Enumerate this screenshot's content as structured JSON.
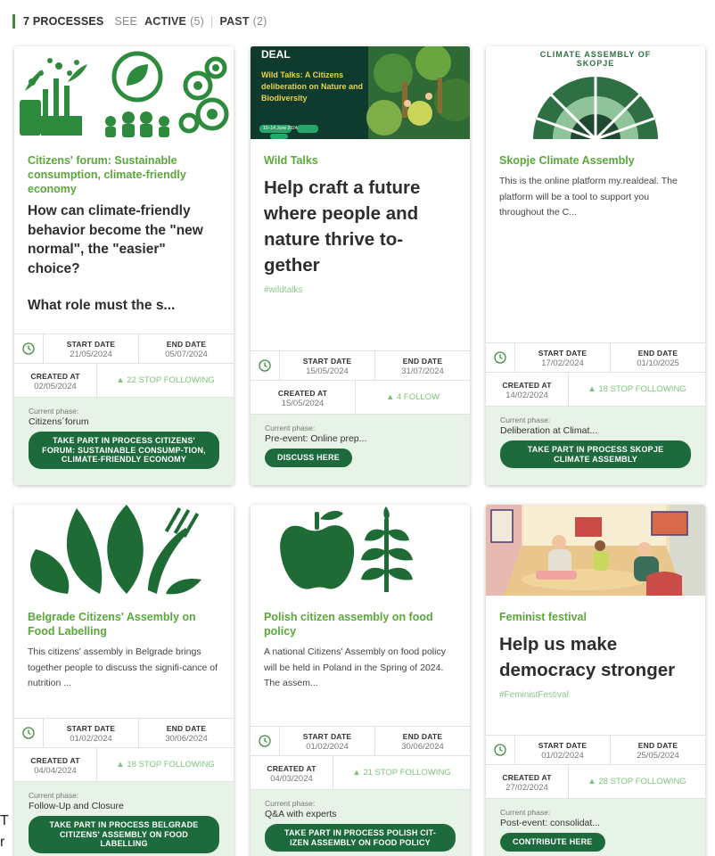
{
  "filter": {
    "total": "7 PROCESSES",
    "see": "SEE",
    "active_label": "ACTIVE",
    "active_count": "(5)",
    "separator": "|",
    "past_label": "PAST",
    "past_count": "(2)"
  },
  "labels": {
    "start_date": "START DATE",
    "end_date": "END DATE",
    "created_at": "CREATED AT",
    "current_phase": "Current phase:"
  },
  "colors": {
    "accent_green": "#5aa83a",
    "button_green": "#1d6b3c",
    "footer_bg": "#e6f3e6"
  },
  "cards": [
    {
      "title": "Citizens' forum: Sustainable consumption, climate-friendly economy",
      "subtitle": "How can climate-friendly behavior become the \"new normal\", the \"easier\" choice?",
      "subtitle2": "What role must the s...",
      "start_date": "21/05/2024",
      "end_date": "05/07/2024",
      "created_at": "02/05/2024",
      "follow": "▲ 22 STOP FOLLOWING",
      "current_phase": "Citizens´forum",
      "button": "TAKE PART IN PROCESS CITIZENS' FORUM: SUSTAINABLE CONSUMP-TION, CLIMATE-FRIENDLY ECONOMY"
    },
    {
      "title": "Wild Talks",
      "subtitle": "Help craft a future where people and nature thrive to-gether",
      "hashtag": "#wildtalks",
      "banner_brand": "DEAL",
      "banner_title": "Wild Talks: A Citizens deliberation on Nature and Biodiversity",
      "banner_date": "10–14 June 2024",
      "start_date": "15/05/2024",
      "end_date": "31/07/2024",
      "created_at": "15/05/2024",
      "follow": "▲ 4 FOLLOW",
      "current_phase": "Pre-event: Online prep...",
      "button": "DISCUSS HERE"
    },
    {
      "title": "Skopje Climate Assembly",
      "desc": "This is the online platform my.realdeal. The platform will be a tool to support you throughout the C...",
      "banner_text": "CLIMATE ASSEMBLY OF SKOPJE",
      "start_date": "17/02/2024",
      "end_date": "01/10/2025",
      "created_at": "14/02/2024",
      "follow": "▲ 18 STOP FOLLOWING",
      "current_phase": "Deliberation at Climat...",
      "button": "TAKE PART IN PROCESS SKOPJE CLIMATE ASSEMBLY"
    },
    {
      "title": "Belgrade Citizens' Assembly on Food Labelling",
      "desc": "This citizens' assembly in Belgrade brings together people to discuss the signifi-cance of nutrition ...",
      "start_date": "01/02/2024",
      "end_date": "30/06/2024",
      "created_at": "04/04/2024",
      "follow": "▲ 18 STOP FOLLOWING",
      "current_phase": "Follow-Up and Closure",
      "button": "TAKE PART IN PROCESS BELGRADE CITIZENS' ASSEMBLY ON FOOD LABELLING"
    },
    {
      "title": "Polish citizen assembly on food policy",
      "desc": "A national Citizens' Assembly on food policy will be held in Poland in the Spring of 2024. The assem...",
      "start_date": "01/02/2024",
      "end_date": "30/06/2024",
      "created_at": "04/03/2024",
      "follow": "▲ 21 STOP FOLLOWING",
      "current_phase": "Q&A with experts",
      "button": "TAKE PART IN PROCESS POLISH CIT-IZEN ASSEMBLY ON FOOD POLICY"
    },
    {
      "title": "Feminist festival",
      "subtitle": "Help us make democracy stronger",
      "hashtag": "#FeministFestival",
      "start_date": "01/02/2024",
      "end_date": "25/05/2024",
      "created_at": "27/02/2024",
      "follow": "▲ 28 STOP FOLLOWING",
      "current_phase": "Post-event: consolidat...",
      "button": "CONTRIBUTE HERE"
    }
  ],
  "edge_glyphs": [
    "T",
    "r"
  ]
}
